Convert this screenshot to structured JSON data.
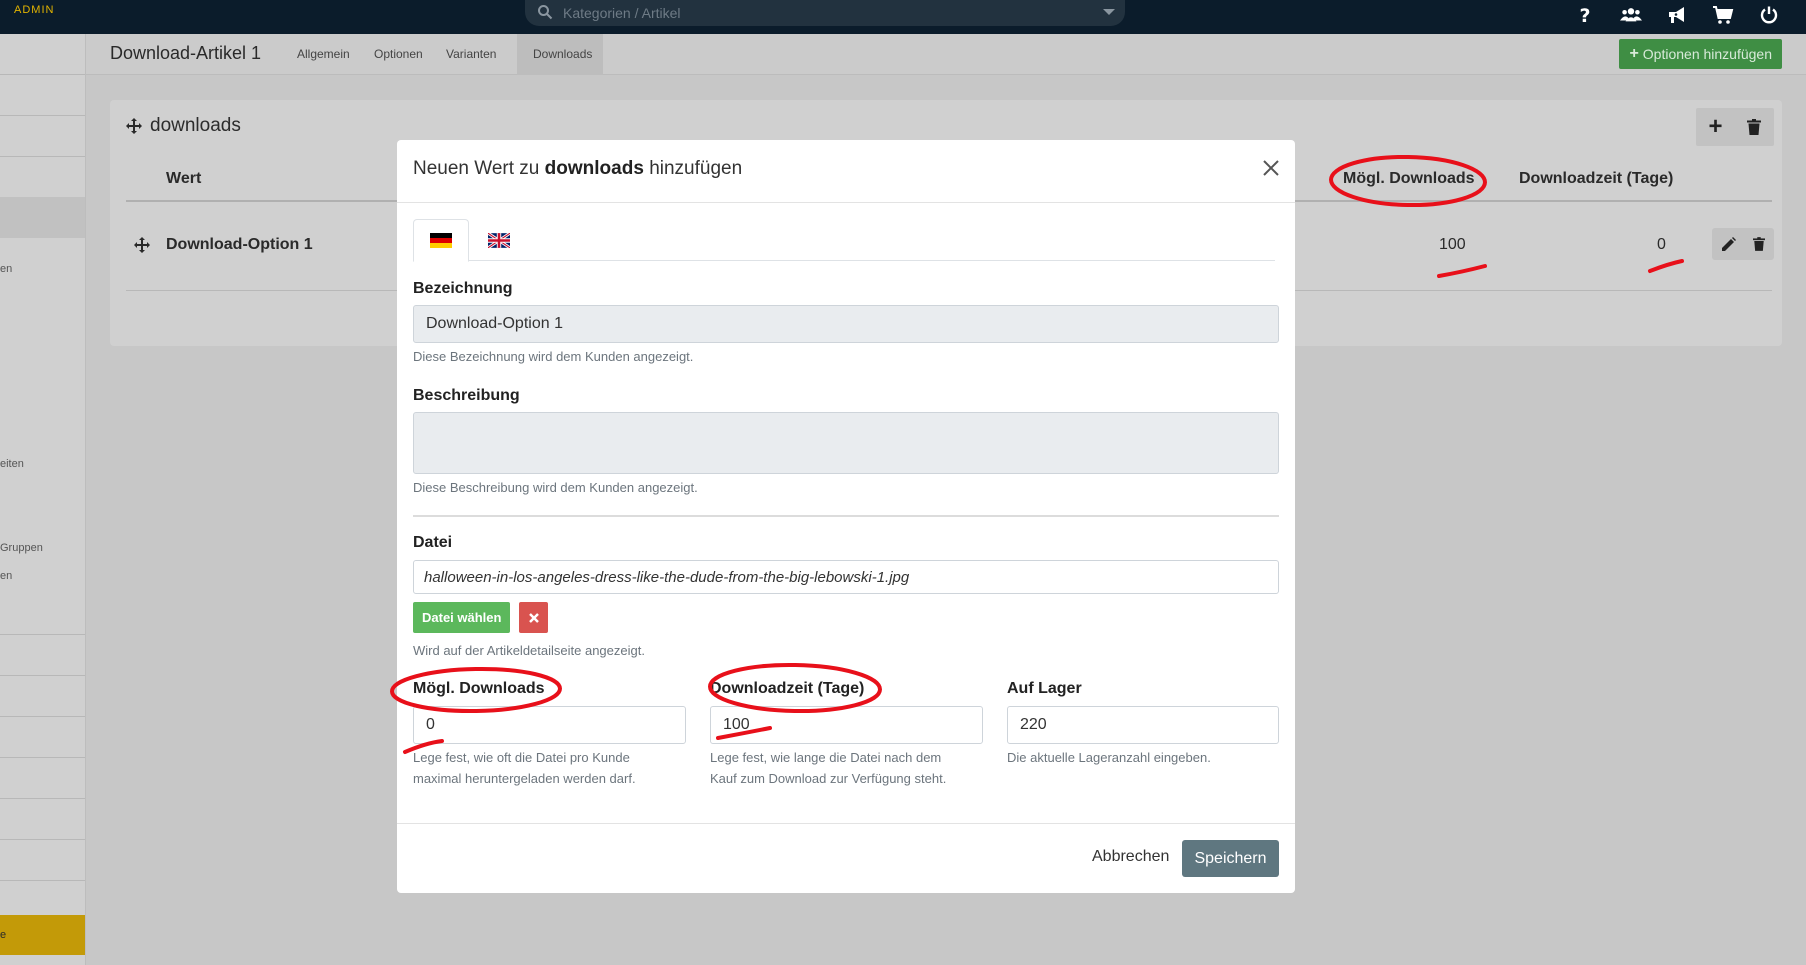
{
  "topbar": {
    "admin_label": "ADMIN",
    "search_placeholder": "Kategorien / Artikel",
    "icons": [
      "help-icon",
      "users-icon",
      "megaphone-icon",
      "cart-icon",
      "power-icon"
    ]
  },
  "sidebar": {
    "fragments": [
      "en",
      "eiten",
      "Gruppen",
      "en",
      "e"
    ]
  },
  "subheader": {
    "title": "Download-Artikel 1",
    "tabs": [
      "Allgemein",
      "Optionen",
      "Varianten",
      "Downloads"
    ],
    "active_tab": "Downloads",
    "add_options_label": "Optionen hinzufügen"
  },
  "panel": {
    "title": "downloads",
    "columns": {
      "value": "Wert",
      "downloads": "Mögl. Downloads",
      "download_time": "Downloadzeit (Tage)"
    },
    "rows": [
      {
        "value": "Download-Option 1",
        "downloads": "100",
        "download_time": "0"
      }
    ]
  },
  "modal": {
    "title_prefix": "Neuen Wert zu",
    "title_bold": "downloads",
    "title_suffix": "hinzufügen",
    "languages": [
      "de",
      "en"
    ],
    "name": {
      "label": "Bezeichnung",
      "value": "Download-Option 1",
      "help": "Diese Bezeichnung wird dem Kunden angezeigt."
    },
    "description": {
      "label": "Beschreibung",
      "value": "",
      "help": "Diese Beschreibung wird dem Kunden angezeigt."
    },
    "file": {
      "label": "Datei",
      "value": "halloween-in-los-angeles-dress-like-the-dude-from-the-big-lebowski-1.jpg",
      "choose_label": "Datei wählen",
      "help": "Wird auf der Artikeldetailseite angezeigt."
    },
    "max_downloads": {
      "label": "Mögl. Downloads",
      "value": "0",
      "help_line1": "Lege fest, wie oft die Datei pro Kunde",
      "help_line2": "maximal heruntergeladen werden darf."
    },
    "download_time": {
      "label": "Downloadzeit (Tage)",
      "value": "100",
      "help_line1": "Lege fest, wie lange die Datei nach dem",
      "help_line2": "Kauf zum Download zur Verfügung steht."
    },
    "stock": {
      "label": "Auf Lager",
      "value": "220",
      "help": "Die aktuelle Lageranzahl eingeben."
    },
    "cancel_label": "Abbrechen",
    "save_label": "Speichern"
  },
  "colors": {
    "topbar": "#0b1c2b",
    "admin_accent": "#e3b400",
    "success": "#5cb85c",
    "danger": "#d9534f",
    "save": "#5f7780",
    "annotation": "#e8101a"
  }
}
